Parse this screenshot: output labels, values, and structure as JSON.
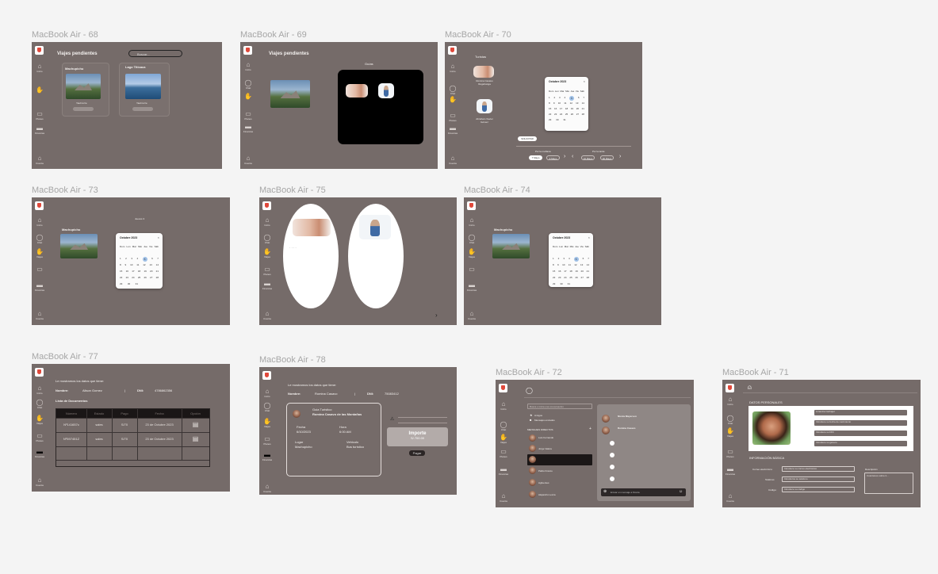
{
  "frames": {
    "f68": {
      "label": "MacBook Air - 68",
      "title": "Viajes pendientes",
      "search_placeholder": "Buscar...",
      "card1": "Machupichu",
      "card2": "Lago Titicaca",
      "card_sub": "Yauli·torre"
    },
    "f69": {
      "label": "MacBook Air - 69",
      "title": "Viajes pendientes",
      "guide_label": "Guías"
    },
    "f70": {
      "label": "MacBook Air - 70",
      "header": "Turistas",
      "name1": "Romina Casavo Regehanga",
      "name2": "Abraham Xavier Gómez",
      "month": "Octubre 2023",
      "btn_solicitar": "SOLICITAR",
      "por_manana": "Por la mañana",
      "por_tarde": "Por la tarde",
      "opt1": "7 Mayo",
      "opt2": "9 Mayo",
      "opt3": "16 Mayo",
      "opt4": "30 Mayo"
    },
    "f73": {
      "label": "MacBook Air - 73",
      "place": "Machupichu",
      "info": "Jueves 3",
      "month": "Octubre 2023"
    },
    "f75": {
      "label": "MacBook Air - 75"
    },
    "f74": {
      "label": "MacBook Air - 74",
      "place": "Machupichu",
      "month": "Octubre 2023"
    },
    "f77": {
      "label": "MacBook Air - 77",
      "intro": "Le mostramos los datos que tiene:",
      "nombre_label": "Nombre:",
      "nombre_value": "Alison Gomez",
      "sep": "|",
      "dni_label": "DNI:",
      "dni_value": "4786862356",
      "docs_title": "Lista de Documentos",
      "headers": [
        "Número",
        "Estado",
        "Pago",
        "Fecha",
        "Opción"
      ],
      "rows": [
        [
          "Nº141657c",
          "sales",
          "S/70",
          "23 de Octubre 2023"
        ],
        [
          "Nº597451Z",
          "sales",
          "S/70",
          "23 de Octubre 2023"
        ]
      ]
    },
    "f78": {
      "label": "MacBook Air - 78",
      "intro": "Le mostramos los datos que tiene:",
      "nombre_label": "Nombre:",
      "nombre_value": "Romina Casavo",
      "sep": "|",
      "dni_label": "DNI:",
      "dni_value": "75083412",
      "guide_title": "Guia Turistico",
      "guide_name": "Romina Casavo de las Montañas",
      "fecha_label": "Fecha",
      "fecha_value": "6/10/2023",
      "hora_label": "Hora",
      "hora_value": "6:00 AM",
      "lugar_label": "Lugar",
      "lugar_value": "Machupicho",
      "vehiculo_label": "Vehiculo",
      "vehiculo_value": "Bus turístico",
      "importe_label": "Importe",
      "importe_value": "S/.700.00",
      "pagar": "Pagar"
    },
    "f72": {
      "label": "MacBook Air - 72",
      "search_placeholder": "Busca o inicia una conversación",
      "menu": [
        "Amigos",
        "Mensajes enviados"
      ],
      "section": "MENSAJES DIRECTOS",
      "contacts": [
        "Luis Fernando",
        "Jorge Valera",
        "",
        "Pablo Franco",
        "Agfuentes",
        "Alejandro Lecca"
      ],
      "chat_names": [
        "Nicola Mayerson",
        "Romina Casavo"
      ],
      "chat_placeholder": "Enviar un mensaje a Nicola"
    },
    "f71": {
      "label": "MacBook Air - 71",
      "section1": "DATOS PERSONALES",
      "fields": [
        "Lizandra Carbajal",
        "Introduce su fecha de nacimiento",
        "Introduce su DNI",
        "Introduce su género"
      ],
      "section2": "INFORMACIÓN BÁSICA",
      "correo_label": "Correo electrónico:",
      "correo_ph": "Introduce su correo electrónico",
      "telefono_label": "Teléfono:",
      "telefono_ph": "Introduzca su teléfono",
      "codigo_label": "Código:",
      "codigo_ph": "Introduce su código",
      "desc_label": "Descripción",
      "desc_ph": "Cuéntanos sobre ti..."
    }
  },
  "sidebar": {
    "inicio": "Inicio",
    "chat": "Chat",
    "viajes": "Viajes",
    "planes": "Planes",
    "finanzas": "Finanzas",
    "cuenta": "Cuenta"
  }
}
